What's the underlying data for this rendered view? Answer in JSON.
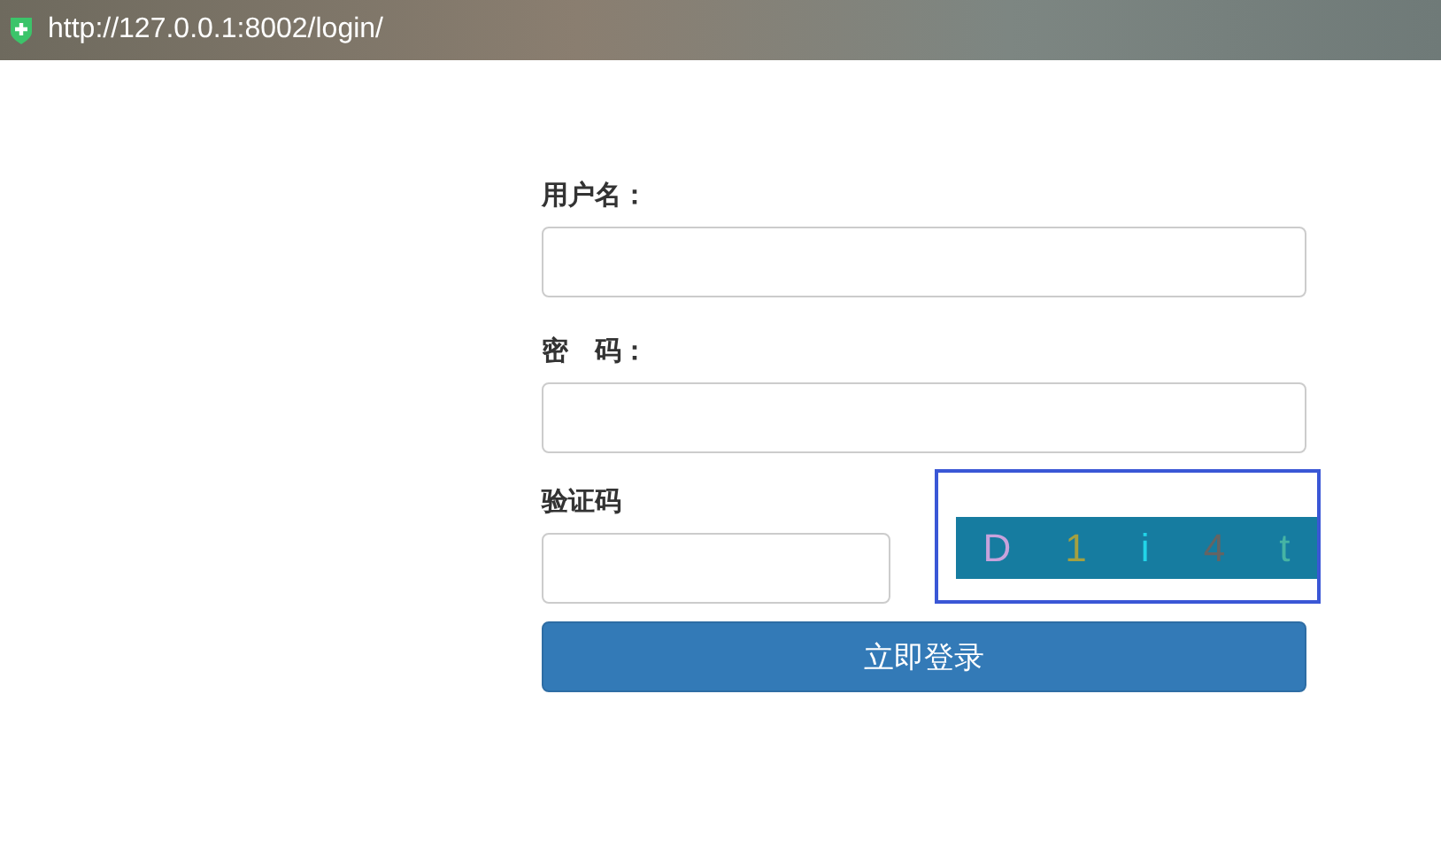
{
  "address_bar": {
    "url": "http://127.0.0.1:8002/login/"
  },
  "form": {
    "fields": [
      {
        "label": "用户名："
      },
      {
        "label": "密　码："
      }
    ],
    "captcha": {
      "label": "验证码",
      "characters": [
        {
          "char": "D",
          "color": "#c8a2dc"
        },
        {
          "char": "1",
          "color": "#a4a040"
        },
        {
          "char": "i",
          "color": "#22d4e8"
        },
        {
          "char": "4",
          "color": "#646464"
        },
        {
          "char": "t",
          "color": "#46b4a4"
        }
      ]
    },
    "submit": "立即登录"
  }
}
